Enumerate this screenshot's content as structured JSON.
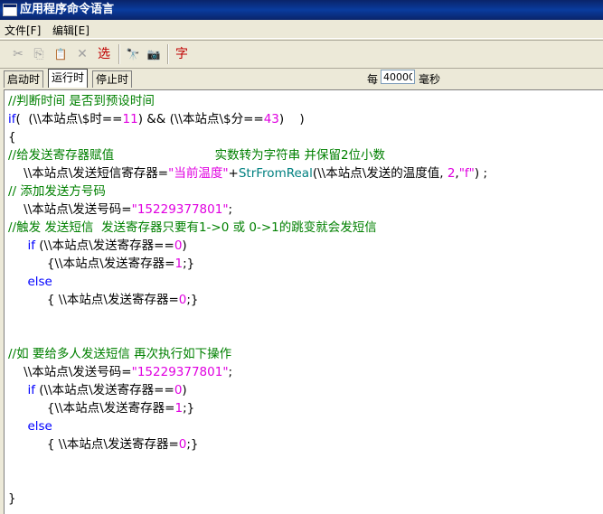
{
  "window": {
    "title": "应用程序命令语言"
  },
  "menu": [
    {
      "label": "文件[F]"
    },
    {
      "label": "编辑[E]"
    }
  ],
  "toolbar": {
    "cut_icon": "✂",
    "copy_icon": "⎘",
    "paste_icon": "📋",
    "delete_icon": "✕",
    "select_label": "选",
    "find_icon": "🔭",
    "camera_icon": "📷",
    "font_label": "字"
  },
  "tabs": [
    {
      "label": "启动时"
    },
    {
      "label": "运行时",
      "active": true
    },
    {
      "label": "停止时"
    }
  ],
  "interval": {
    "prefix": "每",
    "value": "40000",
    "unit": "毫秒"
  },
  "code": [
    [
      {
        "t": "//判断时间 是否到预设时间",
        "c": "comment"
      }
    ],
    [
      {
        "t": "if",
        "c": "keyword"
      },
      {
        "t": "(  (\\\\本站点\\$时=="
      },
      {
        "t": "11",
        "c": "number"
      },
      {
        "t": ") && (\\\\本站点\\$分=="
      },
      {
        "t": "43",
        "c": "number"
      },
      {
        "t": ")    )"
      }
    ],
    [
      {
        "t": "{"
      }
    ],
    [
      {
        "t": "//给发送寄存器赋值                          实数转为字符串 并保留2位小数",
        "c": "comment"
      }
    ],
    [
      {
        "t": "    \\\\本站点\\发送短信寄存器="
      },
      {
        "t": "\"当前温度\"",
        "c": "string"
      },
      {
        "t": "+"
      },
      {
        "t": "StrFromReal",
        "c": "func"
      },
      {
        "t": "(\\\\本站点\\发送的温度值, "
      },
      {
        "t": "2",
        "c": "number"
      },
      {
        "t": ","
      },
      {
        "t": "\"f\"",
        "c": "string"
      },
      {
        "t": ") ;"
      }
    ],
    [
      {
        "t": "// 添加发送方号码",
        "c": "comment"
      }
    ],
    [
      {
        "t": "    \\\\本站点\\发送号码="
      },
      {
        "t": "\"15229377801\"",
        "c": "string"
      },
      {
        "t": ";"
      }
    ],
    [
      {
        "t": "//触发 发送短信  发送寄存器只要有1->0 或 0->1的跳变就会发短信",
        "c": "comment"
      }
    ],
    [
      {
        "t": "     "
      },
      {
        "t": "if",
        "c": "keyword"
      },
      {
        "t": " (\\\\本站点\\发送寄存器=="
      },
      {
        "t": "0",
        "c": "number"
      },
      {
        "t": ")"
      }
    ],
    [
      {
        "t": "          {\\\\本站点\\发送寄存器="
      },
      {
        "t": "1",
        "c": "number"
      },
      {
        "t": ";}"
      }
    ],
    [
      {
        "t": "     "
      },
      {
        "t": "else",
        "c": "keyword"
      }
    ],
    [
      {
        "t": "          { \\\\本站点\\发送寄存器="
      },
      {
        "t": "0",
        "c": "number"
      },
      {
        "t": ";}"
      }
    ],
    [],
    [],
    [
      {
        "t": "//如 要给多人发送短信 再次执行如下操作",
        "c": "comment"
      }
    ],
    [
      {
        "t": "    \\\\本站点\\发送号码="
      },
      {
        "t": "\"15229377801\"",
        "c": "string"
      },
      {
        "t": ";"
      }
    ],
    [
      {
        "t": "     "
      },
      {
        "t": "if",
        "c": "keyword"
      },
      {
        "t": " (\\\\本站点\\发送寄存器=="
      },
      {
        "t": "0",
        "c": "number"
      },
      {
        "t": ")"
      }
    ],
    [
      {
        "t": "          {\\\\本站点\\发送寄存器="
      },
      {
        "t": "1",
        "c": "number"
      },
      {
        "t": ";}"
      }
    ],
    [
      {
        "t": "     "
      },
      {
        "t": "else",
        "c": "keyword"
      }
    ],
    [
      {
        "t": "          { \\\\本站点\\发送寄存器="
      },
      {
        "t": "0",
        "c": "number"
      },
      {
        "t": ";}"
      }
    ],
    [],
    [],
    [
      {
        "t": "}"
      }
    ]
  ],
  "colors": {
    "comment": "#008000",
    "keyword": "#0000ff",
    "number": "#e000e0",
    "string": "#e000e0",
    "function": "#008080",
    "titlebar": "#0a246a"
  }
}
